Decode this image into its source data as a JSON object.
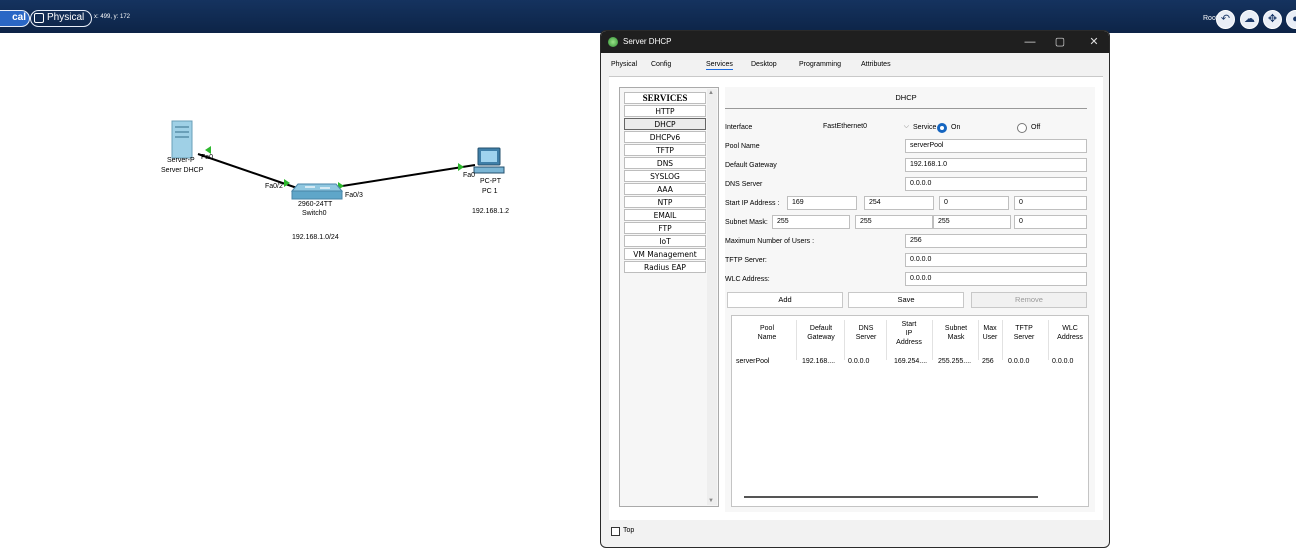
{
  "topbar": {
    "logical_label": "cal",
    "physical_label": "Physical",
    "coords": "x: 499, y: 172",
    "root_label": "Root",
    "buttons": [
      {
        "icon": "back-arrow-icon",
        "glyph": "↶"
      },
      {
        "icon": "cloud-icon",
        "glyph": "☁"
      },
      {
        "icon": "move-icon",
        "glyph": "✥"
      },
      {
        "icon": "more-icon",
        "glyph": "●"
      }
    ]
  },
  "topology": {
    "server": {
      "name1": "Server-P",
      "name2": "Server DHCP",
      "port": "Fa0"
    },
    "switch": {
      "model": "2960-24TT",
      "name": "Switch0",
      "port_left": "Fa0/2",
      "port_right": "Fa0/3",
      "network": "192.168.1.0/24"
    },
    "pc": {
      "model": "PC-PT",
      "name": "PC 1",
      "port": "Fa0",
      "ip": "192.168.1.2"
    }
  },
  "window": {
    "title": "Server DHCP",
    "controls": {
      "minimize": "—",
      "maximize": "▢",
      "close": "✕"
    },
    "tabs": [
      "Physical",
      "Config",
      "Services",
      "Desktop",
      "Programming",
      "Attributes"
    ],
    "active_tab": "Services",
    "services_header": "SERVICES",
    "services": [
      "HTTP",
      "DHCP",
      "DHCPv6",
      "TFTP",
      "DNS",
      "SYSLOG",
      "AAA",
      "NTP",
      "EMAIL",
      "FTP",
      "IoT",
      "VM Management",
      "Radius EAP"
    ],
    "selected_service": "DHCP",
    "top_label": "Top"
  },
  "dhcp": {
    "title": "DHCP",
    "interface_label": "Interface",
    "interface_value": "FastEthernet0",
    "service_label": "Service",
    "on_label": "On",
    "off_label": "Off",
    "service_on": true,
    "pool_name_label": "Pool Name",
    "pool_name": "serverPool",
    "gateway_label": "Default Gateway",
    "gateway": "192.168.1.0",
    "dns_label": "DNS Server",
    "dns": "0.0.0.0",
    "start_ip_label": "Start IP Address :",
    "start_ip": [
      "169",
      "254",
      "0",
      "0"
    ],
    "mask_label": "Subnet Mask:",
    "mask": [
      "255",
      "255",
      "255",
      "0"
    ],
    "max_users_label": "Maximum Number of Users :",
    "max_users": "256",
    "tftp_label": "TFTP Server:",
    "tftp": "0.0.0.0",
    "wlc_label": "WLC Address:",
    "wlc": "0.0.0.0",
    "buttons": {
      "add": "Add",
      "save": "Save",
      "remove": "Remove"
    },
    "table": {
      "headers": [
        [
          "Pool",
          "Name"
        ],
        [
          "Default",
          "Gateway"
        ],
        [
          "DNS",
          "Server"
        ],
        [
          "Start",
          "IP",
          "Address"
        ],
        [
          "Subnet",
          "Mask"
        ],
        [
          "Max",
          "User"
        ],
        [
          "TFTP",
          "Server"
        ],
        [
          "WLC",
          "Address"
        ]
      ],
      "rows": [
        [
          "serverPool",
          "192.168....",
          "0.0.0.0",
          "169.254....",
          "255.255....",
          "256",
          "0.0.0.0",
          "0.0.0.0"
        ]
      ]
    }
  }
}
